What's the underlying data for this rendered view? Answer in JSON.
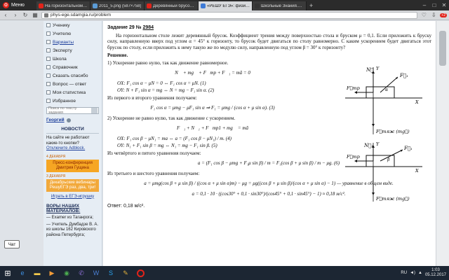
{
  "browser": {
    "menu_label": "Меню",
    "tabs": [
      {
        "label": "На горизонтальном столе",
        "color": "#e2231a",
        "active": false
      },
      {
        "label": "2011_5.png (587×758)",
        "color": "#5b9bd5",
        "active": false
      },
      {
        "label": "Деревянный брусок лежи",
        "color": "#e2231a",
        "active": false
      },
      {
        "label": "«РЕШУ ЕГЭ»: физика. ЕГЭ",
        "color": "#3d7ad6",
        "active": true
      },
      {
        "label": "Школьные Знания.com",
        "color": "#333333",
        "active": false
      }
    ],
    "new_tab": "+",
    "url": "phys-ege.sdamgia.ru/problem",
    "badge_count": "+2"
  },
  "sidebar": {
    "items": [
      {
        "label": "Ученику",
        "link": false
      },
      {
        "label": "Учителю",
        "link": false
      },
      {
        "label": "Варианты",
        "link": true
      },
      {
        "label": "Эксперту",
        "link": false
      },
      {
        "label": "Школа",
        "link": false
      },
      {
        "label": "Справочник",
        "link": false
      },
      {
        "label": "Сказать спасибо",
        "link": false
      },
      {
        "label": "Вопрос — ответ",
        "link": false
      },
      {
        "label": "Моя статистика",
        "link": false
      },
      {
        "label": "Избранное",
        "link": false
      }
    ],
    "search_placeholder": "Поиск по тексту задания",
    "user_name": "Георгий",
    "news_title": "НОВОСТИ",
    "notice_text": "На сайте не работают какие-то кнопки?",
    "notice_link": "Отключите Adblock.",
    "news": [
      {
        "date": "4 ДЕКАБРЯ",
        "text": "Пресс-конференция Дмитрия Гущина"
      },
      {
        "date": "3 ДЕКАБРЯ",
        "text": "Декабрьские вебинары РешуЕГЭ раз, два, три!"
      }
    ],
    "play_link": "Играть в ЕГЭ-игрушку",
    "materials_title": "ВОРЫ НАШИХ МАТЕРИАЛОВ:",
    "materials_items": [
      "— Examer из Таганрога;",
      "— Учитель Думбадзе В. А. из школы 162 Кировского района Петербурга;"
    ]
  },
  "task": {
    "head_prefix": "Задание 29 №",
    "number": "2984",
    "text": "На горизонтальном столе лежит деревянный брусок. Коэффициент трения между поверхностью стола и бруском μ = 0,1. Если приложить к бруску силу, направленную вверх под углом α = 45° к горизонту, то брусок будет двигаться по столу равномерно. С каким ускорением будет двигаться этот брусок по столу, если приложить к нему такую же по модулю силу, направленную под углом β = 30° к горизонту?",
    "solution_title": "Решение.",
    "step1": "1) Ускорение равно нулю, так как движение равномерное.",
    "eq1": "N⃗ + mg⃗ + F⃗тр + F⃗₁ = mā = 0",
    "ox1": "OX:  F₁ cos α − μN = 0 ⇔ F₁ cos α = μN. (1)",
    "oy1": "OY:  N + F₁ sin α = mg ⇔ N = mg − F₁ sin α. (2)",
    "from12": "Из первого и второго уравнения получаем:",
    "eq_f": "F₁ cos α = μmg − μF₁ sin α ⇒ F₁ = μmg / (cos α + μ sin α). (3)",
    "step2": "2) Ускорение не равно нулю, так как движение с ускорением.",
    "eq2": "F⃗₁ + N⃗₁ + F⃗тр1 + mg⃗ = mā",
    "ox2": "OX:  F₁ cos β − μN₁ = ma ⇔ a = (F₁ cos β − μN₁) / m. (4)",
    "oy2": "OY:  N₁ + F₁ sin β = mg ⇔ N₁ = mg − F₁ sin β. (5)",
    "from45": "Из четвёртого и пятого уравнения получаем:",
    "eq_a1": "a = (F₁ cos β − μmg + F₁μ sin β) / m = F₁(cos β + μ sin β) / m − μg. (6)",
    "from36": "Из третьего и шестого уравнения получаем:",
    "eq_a2": "a = μmg(cos β + μ sin β) / ((cos α + μ sin α)m) − μg = μg((cos β + μ sin β)/(cos α + μ sin α) − 1) — уравнение в общем виде.",
    "eq_a3": "a = 0,1 · 10 · ((cos30° + 0,1 · sin30°)/(cos45° + 0,1 · sin45°) − 1) ≈ 0,18 м/с².",
    "answer": "Ответ: 0,18 м/с²."
  },
  "diagram_labels": {
    "d1": [
      "N⃗",
      "F⃗₁",
      "α",
      "F⃗тр",
      "X",
      "Y",
      "F⃗тяж (mg⃗)"
    ],
    "d2": [
      "N⃗₁",
      "F⃗₁",
      "β",
      "F⃗тр",
      "X",
      "Y",
      "F⃗тяж (mg⃗)"
    ]
  },
  "chat_label": "Чат",
  "taskbar": {
    "lang": "RU",
    "time": "1:03",
    "date": "05.12.2017"
  },
  "colors": {
    "brand_red": "#e2231a",
    "link_blue": "#1d3f9b",
    "news_orange": "#f6a623"
  }
}
